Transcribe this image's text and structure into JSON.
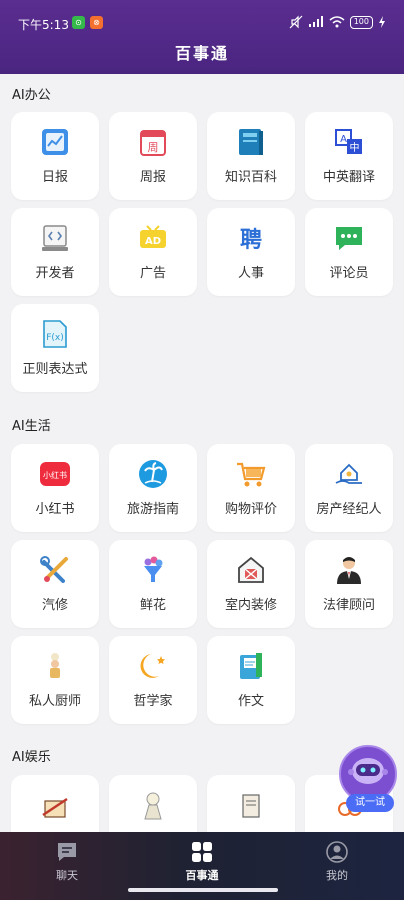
{
  "status_bar": {
    "time": "下午5:13",
    "badge1": "⊙",
    "badge2": "⊗",
    "battery": "100"
  },
  "app_title": "百事通",
  "sections": {
    "office": {
      "title": "AI办公",
      "items": [
        "日报",
        "周报",
        "知识百科",
        "中英翻译",
        "开发者",
        "广告",
        "人事",
        "评论员",
        "正则表达式"
      ]
    },
    "life": {
      "title": "AI生活",
      "items": [
        "小红书",
        "旅游指南",
        "购物评价",
        "房产经纪人",
        "汽修",
        "鲜花",
        "室内装修",
        "法律顾问",
        "私人厨师",
        "哲学家",
        "作文"
      ]
    },
    "fun": {
      "title": "AI娱乐"
    }
  },
  "icon_text": {
    "week": "周",
    "ad": "AD",
    "hire": "聘",
    "xhs": "小红书",
    "regex": "F(x)"
  },
  "float_button": "试一试",
  "tabs": {
    "chat": "聊天",
    "home": "百事通",
    "mine": "我的"
  },
  "colors": {
    "header": "#4a2580",
    "accent": "#4b6cf5",
    "card": "#ffffff",
    "background": "#f2f2f4"
  }
}
